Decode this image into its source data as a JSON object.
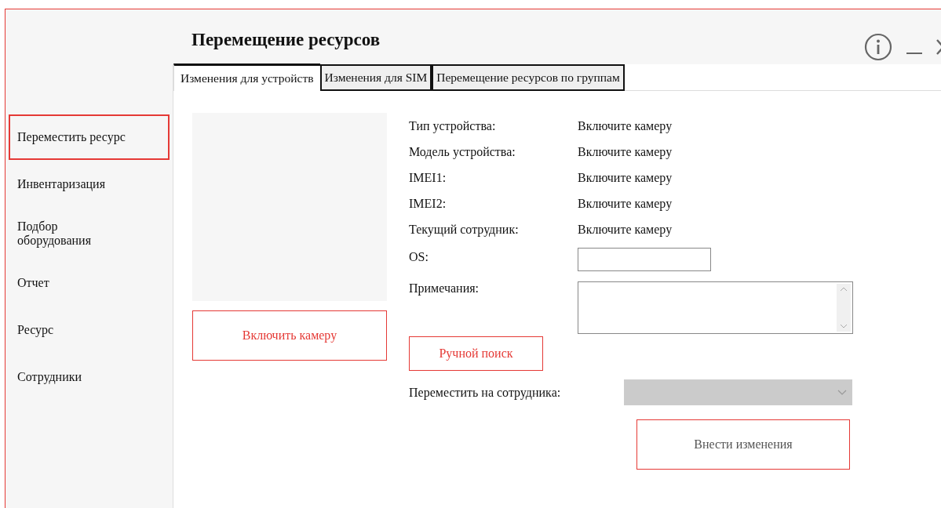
{
  "window": {
    "title": "Перемещение ресурсов"
  },
  "sidebar": {
    "items": [
      {
        "label": "Переместить ресурс",
        "selected": true
      },
      {
        "label": "Инвентаризация",
        "selected": false
      },
      {
        "label": "Подбор оборудования",
        "selected": false
      },
      {
        "label": "Отчет",
        "selected": false
      },
      {
        "label": "Ресурс",
        "selected": false
      },
      {
        "label": "Сотрудники",
        "selected": false
      }
    ]
  },
  "tabs": [
    {
      "label": "Изменения для устройств",
      "selected": true
    },
    {
      "label": "Изменения для SIM",
      "selected": false
    },
    {
      "label": "Перемещение ресурсов по группам",
      "selected": false
    }
  ],
  "camera_button": "Включить камеру",
  "fields": [
    {
      "kind": "text",
      "label": "Тип устройства:",
      "value": "Включите камеру"
    },
    {
      "kind": "text",
      "label": "Модель устройства:",
      "value": "Включите камеру"
    },
    {
      "kind": "text",
      "label": "IMEI1:",
      "value": "Включите камеру"
    },
    {
      "kind": "text",
      "label": "IMEI2:",
      "value": "Включите камеру"
    },
    {
      "kind": "text",
      "label": "Текущий сотрудник:",
      "value": "Включите камеру"
    },
    {
      "kind": "input",
      "label": "OS:"
    },
    {
      "kind": "textarea",
      "label": "Примечания:"
    }
  ],
  "manual_search_button": "Ручной поиск",
  "move_to": {
    "label": "Переместить на сотрудника:",
    "disabled": true
  },
  "submit_button": "Внести изменения"
}
